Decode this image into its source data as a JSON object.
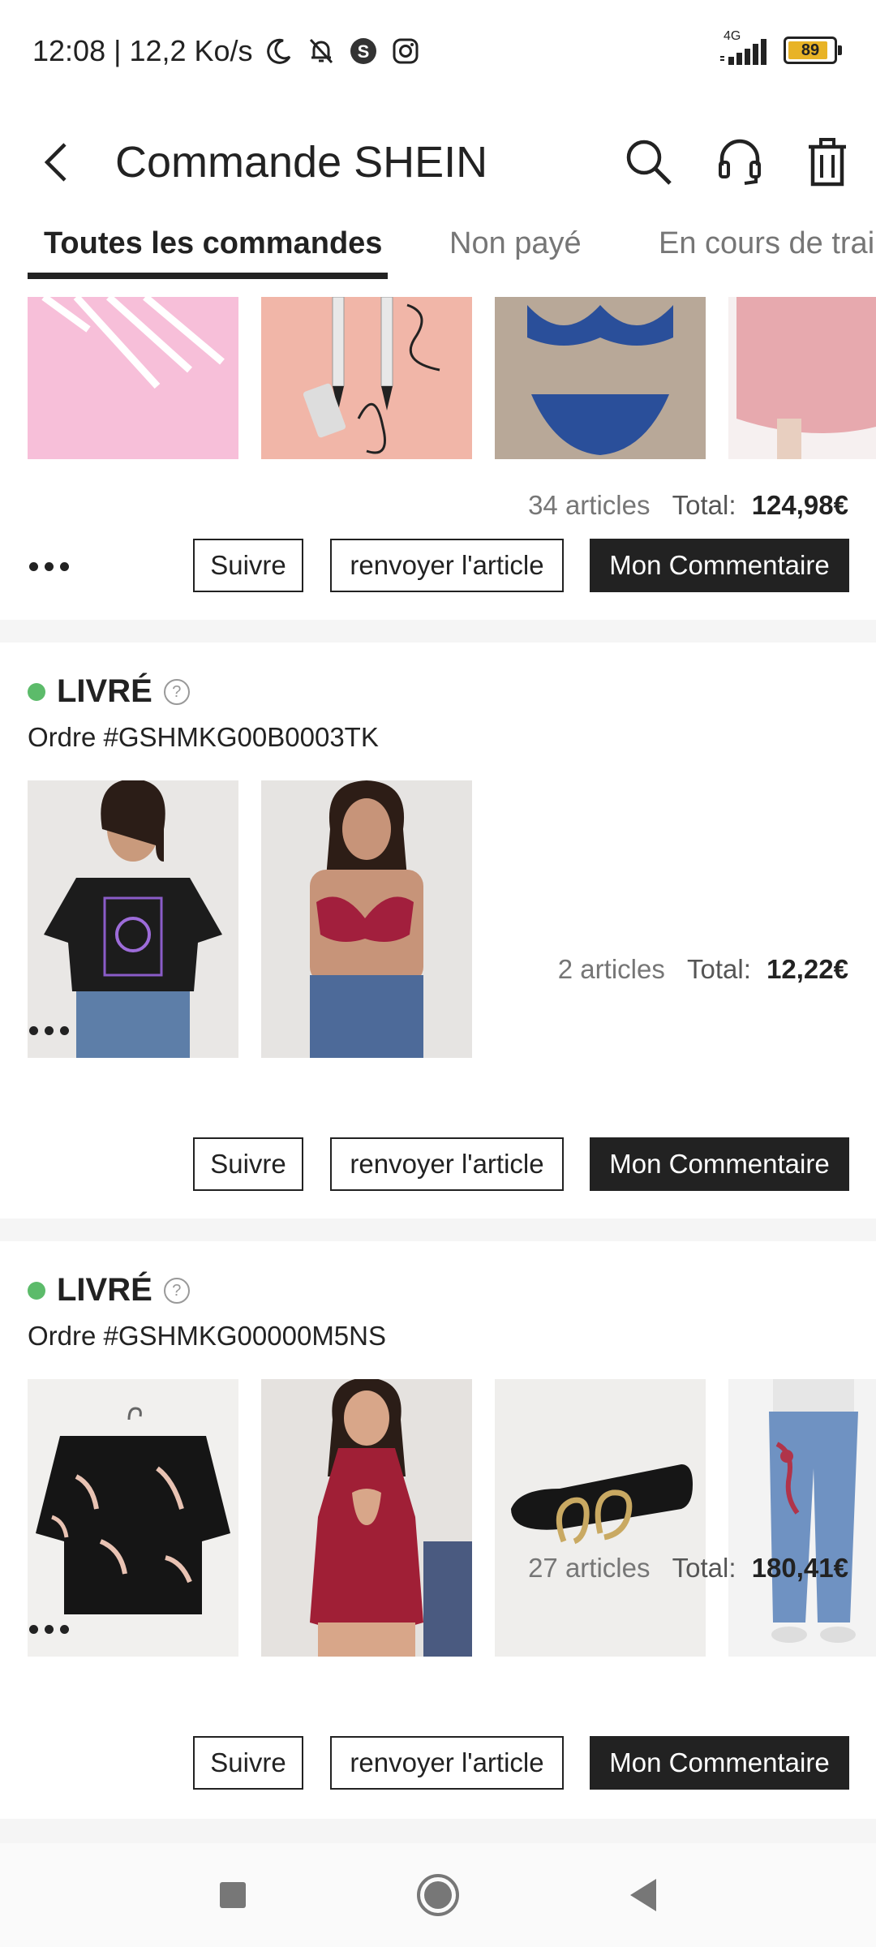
{
  "status_bar": {
    "time_speed": "12:08 | 12,2 Ko/s",
    "network": "4G",
    "battery": "89",
    "battery_level": 0.89,
    "icons": [
      "moon-icon",
      "bell-off-icon",
      "shazam-icon",
      "instagram-icon",
      "signal-icon"
    ]
  },
  "header": {
    "title": "Commande SHEIN",
    "icons": [
      "back-arrow-icon",
      "search-icon",
      "headset-icon",
      "trash-icon"
    ]
  },
  "tabs": [
    {
      "label": "Toutes les commandes",
      "active": true
    },
    {
      "label": "Non payé",
      "active": false
    },
    {
      "label": "En cours de trai",
      "active": false
    }
  ],
  "orders": [
    {
      "articles": "34 articles",
      "total_label": "Total:",
      "total_value": "124,98€",
      "buttons": {
        "follow": "Suivre",
        "return": "renvoyer l'article",
        "review": "Mon Commentaire"
      },
      "thumbnails": [
        "nail-art-brushes",
        "eyeliner-pens",
        "blue-lace-lingerie",
        "pink-satin-skirt"
      ]
    },
    {
      "status": "LIVRÉ",
      "order_number": "Ordre #GSHMKG00B0003TK",
      "articles": "2 articles",
      "total_label": "Total:",
      "total_value": "12,22€",
      "buttons": {
        "follow": "Suivre",
        "return": "renvoyer l'article",
        "review": "Mon Commentaire"
      },
      "thumbnails": [
        "black-graphic-tshirt",
        "red-lace-bralette"
      ]
    },
    {
      "status": "LIVRÉ",
      "order_number": "Ordre #GSHMKG00000M5NS",
      "articles": "27 articles",
      "total_label": "Total:",
      "total_value": "180,41€",
      "buttons": {
        "follow": "Suivre",
        "return": "renvoyer l'article",
        "review": "Mon Commentaire"
      },
      "thumbnails": [
        "black-crane-kimono",
        "red-lace-bodysuit",
        "black-snake-buckle-belt",
        "embroidered-jeggings"
      ]
    }
  ],
  "colors": {
    "accent_dark": "#222222",
    "delivered_green": "#5cbb6a",
    "separator": "#f5f5f5",
    "muted_text": "#767676"
  },
  "nav_bar": {
    "icons": [
      "recent-apps-icon",
      "home-icon",
      "back-nav-icon"
    ]
  }
}
